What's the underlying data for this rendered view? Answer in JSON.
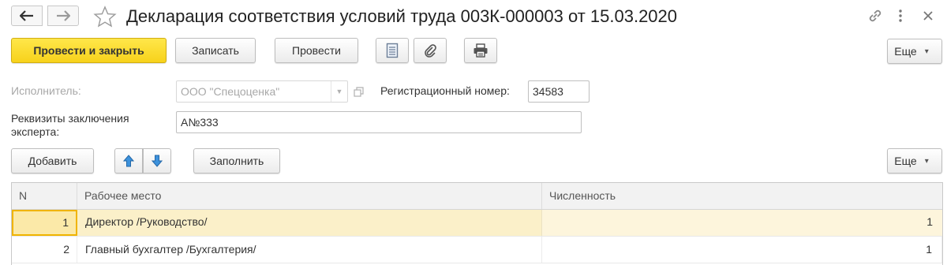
{
  "window": {
    "title": "Декларация соответствия условий труда 003К-000003 от 15.03.2020"
  },
  "nav": {
    "back_icon": "arrow-left-icon",
    "forward_icon": "arrow-right-icon",
    "favorite_icon": "star-icon",
    "link_icon": "link-icon",
    "more_icon": "vertical-dots-icon",
    "close_icon": "close-icon"
  },
  "toolbar": {
    "post_and_close": "Провести и закрыть",
    "save": "Записать",
    "post": "Провести",
    "more": "Еще",
    "icons": [
      "document-list-icon",
      "paperclip-icon",
      "printer-icon"
    ]
  },
  "form": {
    "executor_label": "Исполнитель:",
    "executor_value": "ООО \"Спецоценка\"",
    "reg_number_label": "Регистрационный номер:",
    "reg_number_value": "34583",
    "expert_label_line1": "Реквизиты заключения",
    "expert_label_line2": "эксперта:",
    "expert_value": "А№333"
  },
  "table_toolbar": {
    "add": "Добавить",
    "fill": "Заполнить",
    "more": "Еще",
    "icons": [
      "arrow-up-icon",
      "arrow-down-icon"
    ]
  },
  "table": {
    "columns": [
      "N",
      "Рабочее место",
      "Численность"
    ],
    "rows": [
      {
        "n": "1",
        "place": "Директор /Руководство/",
        "count": "1"
      },
      {
        "n": "2",
        "place": "Главный бухгалтер /Бухгалтерия/",
        "count": "1"
      }
    ]
  },
  "colors": {
    "primary_button": "#f7d21b",
    "selected_row": "#fbf0c9",
    "focus_border": "#f0b400",
    "arrow_blue": "#2e86d6"
  }
}
